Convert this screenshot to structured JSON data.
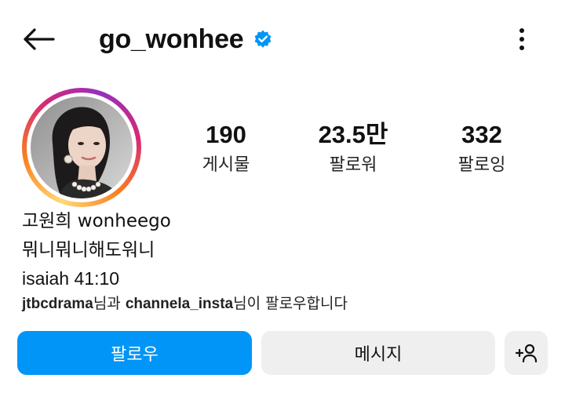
{
  "header": {
    "username": "go_wonhee",
    "verified": true
  },
  "stats": [
    {
      "value": "190",
      "label": "게시물"
    },
    {
      "value": "23.5만",
      "label": "팔로워"
    },
    {
      "value": "332",
      "label": "팔로잉"
    }
  ],
  "bio": {
    "name": "고원희 wonheego",
    "lines": [
      "뭐니뭐니해도워니",
      "isaiah 41:10"
    ]
  },
  "followed_by": {
    "user1": "jtbcdrama",
    "joiner": "님과 ",
    "user2": "channela_insta",
    "suffix": "님이 팔로우합니다"
  },
  "actions": {
    "follow_label": "팔로우",
    "message_label": "메시지"
  },
  "icons": {
    "back": "arrow-left-icon",
    "verified": "verified-badge-icon",
    "more": "more-vertical-icon",
    "add_user": "add-person-icon"
  },
  "colors": {
    "primary": "#0095f6",
    "verified": "#0095f6",
    "secondary_button": "#efefef"
  }
}
